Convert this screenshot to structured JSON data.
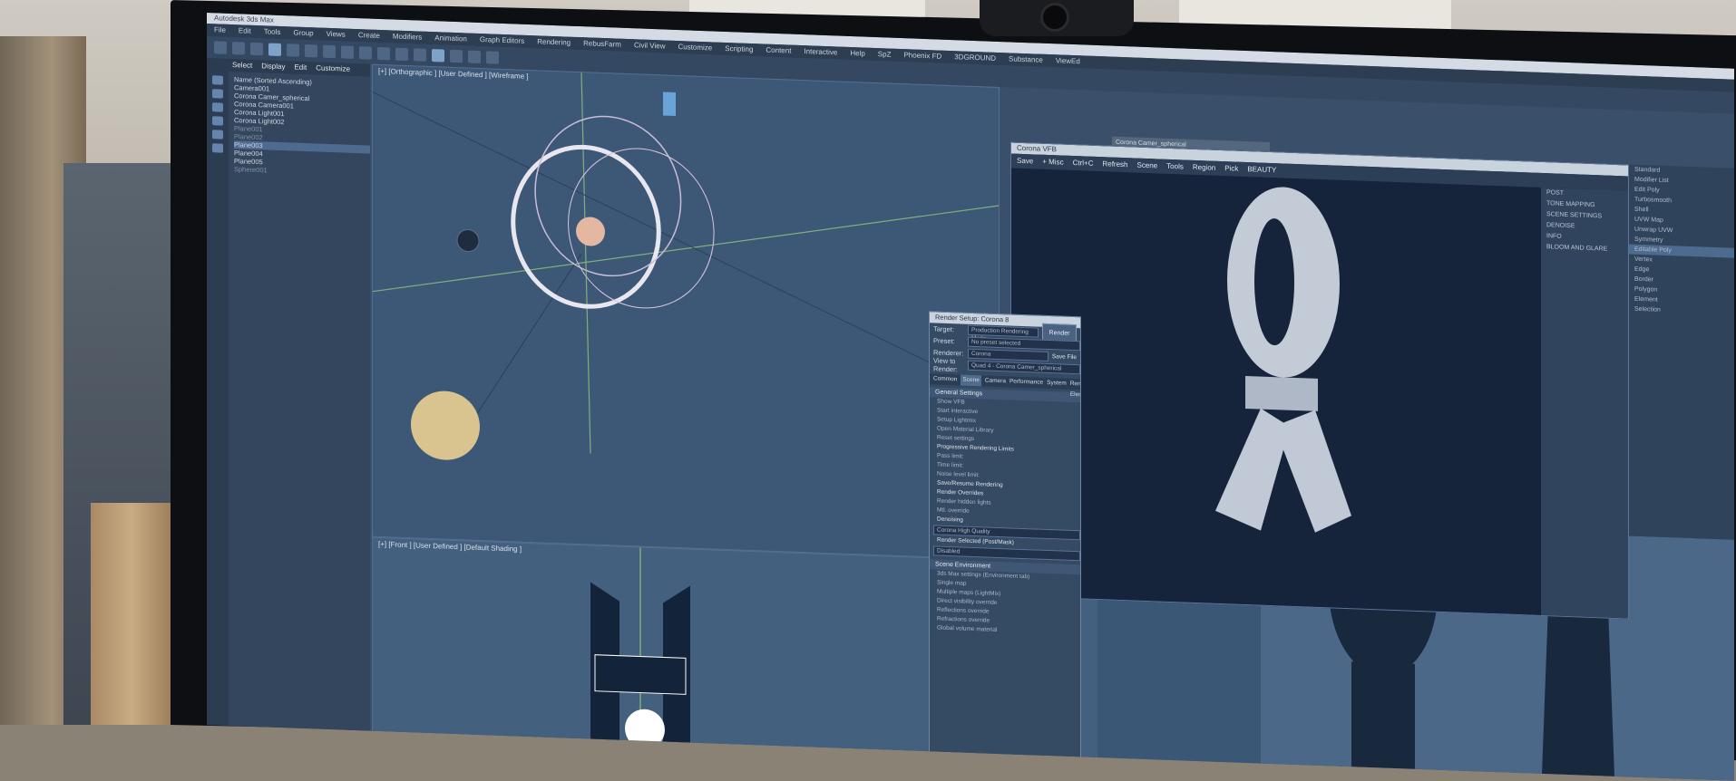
{
  "app": {
    "title": "Autodesk 3ds Max"
  },
  "menu": [
    "File",
    "Edit",
    "Tools",
    "Group",
    "Views",
    "Create",
    "Modifiers",
    "Animation",
    "Graph Editors",
    "Rendering",
    "RebusFarm",
    "Civil View",
    "Customize",
    "Scripting",
    "Content",
    "Interactive",
    "Help",
    "SpZ",
    "Phoenix FD",
    "3DGROUND",
    "Substance",
    "ViewEd"
  ],
  "explorer": {
    "tabs": [
      "Select",
      "Display",
      "Edit",
      "Customize"
    ],
    "header": "Name (Sorted Ascending)",
    "items": [
      "Camera001",
      "Corona Camer_spherical",
      "Corona Camera001",
      "Corona Light001",
      "Corona Light002",
      "Plane001",
      "Plane002",
      "Plane003",
      "Plane004",
      "Plane005",
      "Sphere001"
    ]
  },
  "viewports": {
    "top_label": "[+] [Orthographic ] [User Defined ] [Wireframe ]",
    "bottom_label": "[+] [Front ] [User Defined ] [Default Shading ]"
  },
  "framebuffer": {
    "title": "Corona VFB",
    "toolbar": [
      "Save",
      "+ Misc",
      "Ctrl+C",
      "Refresh",
      "Scene",
      "Tools",
      "Region",
      "Pick",
      "BEAUTY"
    ],
    "panel": [
      "POST",
      "TONE MAPPING",
      "SCENE SETTINGS",
      "DENOISE",
      "INFO",
      "BLOOM AND GLARE"
    ]
  },
  "render_setup": {
    "title": "Render Setup: Corona 8",
    "target_label": "Target:",
    "target_value": "Production Rendering Mode",
    "preset_label": "Preset:",
    "preset_value": "No preset selected",
    "renderer_label": "Renderer:",
    "renderer_value": "Corona",
    "view_label": "View to Render:",
    "view_value": "Quad 4 - Corona Camer_spherical",
    "render_button": "Render",
    "save_file": "Save File",
    "tabs": [
      "Common",
      "Scene",
      "Camera",
      "Performance",
      "System",
      "Render Elements"
    ],
    "section_general": "General Settings",
    "general_lines": [
      "Show VFB",
      "Start interactive",
      "Setup Lightmix",
      "Open Material Library",
      "Reset settings"
    ],
    "progressive": "Progressive Rendering Limits",
    "pass_limit": "Pass limit:",
    "time_limit": "Time limit:",
    "noise_limit": "Noise level limit:",
    "save_resume": "Save/Resume Rendering",
    "overrides": "Render Overrides",
    "render_hidden": "Render hidden lights",
    "mtl_override": "Mtl. override",
    "denoising": "Denoising",
    "denoise_mode": "Corona High Quality",
    "render_selected": "Render Selected (Post/Mask)",
    "render_selected_mode": "Disabled",
    "scene_env": "Scene Environment",
    "env_options": [
      "3ds Max settings (Environment tab)",
      "Single map",
      "Multiple maps (LightMix)"
    ],
    "overrides2": [
      "Direct visibility override",
      "Reflections override",
      "Refractions override",
      "Global volume material"
    ]
  },
  "command_panel": [
    "Standard",
    "Modifier List",
    "Edit Poly",
    "Turbosmooth",
    "Shell",
    "UVW Map",
    "Unwrap UVW",
    "Symmetry",
    "Editable Poly",
    "Vertex",
    "Edge",
    "Border",
    "Polygon",
    "Element",
    "Selection"
  ],
  "status_left": "Corona Camer_spherical"
}
